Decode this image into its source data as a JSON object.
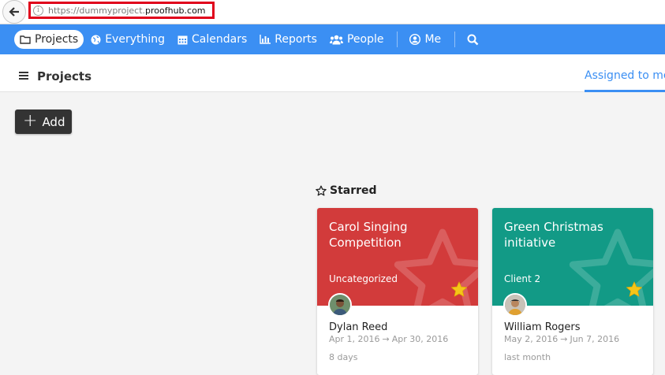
{
  "browser": {
    "url_prefix": "https://dummyproject.",
    "url_domain": "proofhub.com"
  },
  "nav": {
    "items": [
      {
        "label": "Projects",
        "icon": "folder-icon"
      },
      {
        "label": "Everything",
        "icon": "globe-icon"
      },
      {
        "label": "Calendars",
        "icon": "calendar-icon"
      },
      {
        "label": "Reports",
        "icon": "bar-chart-icon"
      },
      {
        "label": "People",
        "icon": "users-icon"
      },
      {
        "label": "Me",
        "icon": "user-circle-icon"
      }
    ],
    "active": "Projects"
  },
  "header": {
    "title": "Projects",
    "assigned_tab": "Assigned to me"
  },
  "add_button": {
    "label": "Add"
  },
  "starred": {
    "heading": "Starred",
    "cards": [
      {
        "title": "Carol Singing Competition",
        "category": "Uncategorized",
        "owner": "Dylan Reed",
        "start": "Apr 1, 2016",
        "end": "Apr 30, 2016",
        "remaining": "8 days",
        "color": "#d23b3b"
      },
      {
        "title": "Green Christmas initiative",
        "category": "Client 2",
        "owner": "William Rogers",
        "start": "May 2, 2016",
        "end": "Jun 7, 2016",
        "remaining": "last month",
        "color": "#129a86"
      }
    ]
  },
  "colors": {
    "nav_bg": "#3b8ff3",
    "accent": "#3b8ff3",
    "star": "#f5c518"
  }
}
